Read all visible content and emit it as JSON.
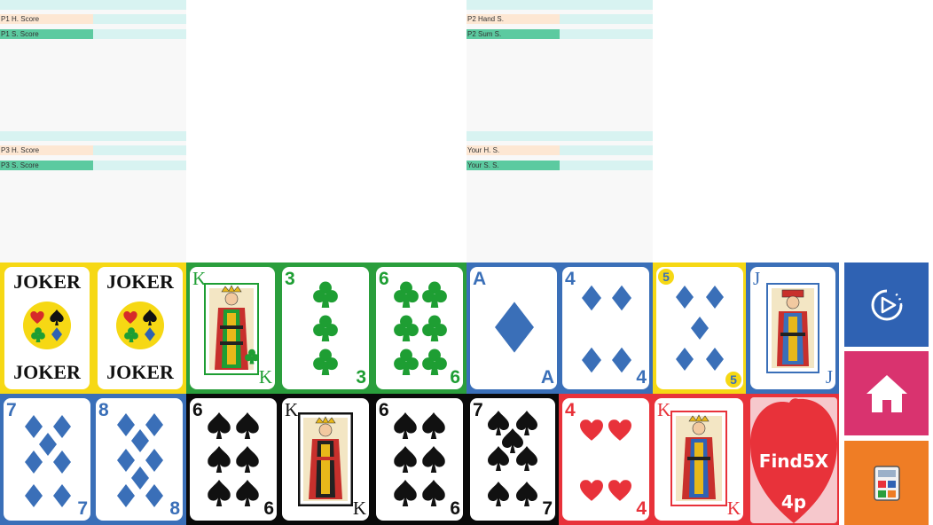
{
  "scoreboard": {
    "p1": {
      "hand_label": "P1 H. Score",
      "sum_label": "P1 S. Score",
      "hand_value": "",
      "sum_value": ""
    },
    "p2": {
      "hand_label": "P2 Hand S.",
      "sum_label": "P2 Sum S.",
      "hand_value": "",
      "sum_value": ""
    },
    "p3": {
      "hand_label": "P3 H. Score",
      "sum_label": "P3 S. Score",
      "hand_value": "",
      "sum_value": ""
    },
    "you": {
      "hand_label": "Your H. S.",
      "sum_label": "Your S. S.",
      "hand_value": "",
      "sum_value": ""
    }
  },
  "cards": {
    "joker1": {
      "word": "JOKER"
    },
    "joker2": {
      "word": "JOKER"
    },
    "c3": {
      "rank": "K",
      "suit": "club"
    },
    "c4": {
      "rank": "3",
      "suit": "club"
    },
    "c5": {
      "rank": "6",
      "suit": "club"
    },
    "c6": {
      "rank": "A",
      "suit": "diamond"
    },
    "c7": {
      "rank": "4",
      "suit": "diamond"
    },
    "c8": {
      "rank": "5",
      "suit": "diamond"
    },
    "c9": {
      "rank": "J",
      "suit": "diamond"
    },
    "c10": {
      "rank": "7",
      "suit": "diamond"
    },
    "c11": {
      "rank": "8",
      "suit": "diamond"
    },
    "c12": {
      "rank": "6",
      "suit": "spade"
    },
    "c13": {
      "rank": "K",
      "suit": "spade"
    },
    "c14": {
      "rank": "6",
      "suit": "spade"
    },
    "c15": {
      "rank": "7",
      "suit": "spade"
    },
    "c16": {
      "rank": "4",
      "suit": "heart"
    },
    "c17": {
      "rank": "K",
      "suit": "heart"
    }
  },
  "logo": {
    "line1": "Find5X",
    "line2": "4p"
  },
  "colors": {
    "yellow": "#f6d814",
    "green": "#2a9e3c",
    "blue": "#3a6fb8",
    "black": "#0a0a0a",
    "red": "#e8323a",
    "club_green": "#1e9e33",
    "diamond_blue": "#3a6fb8",
    "heart_red": "#e8323a",
    "replay_btn": "#2f62b3",
    "home_btn": "#d9336f",
    "calc_btn": "#ef7d25"
  },
  "icons": {
    "replay": "replay-icon",
    "home": "home-icon",
    "calculator": "calculator-icon"
  }
}
